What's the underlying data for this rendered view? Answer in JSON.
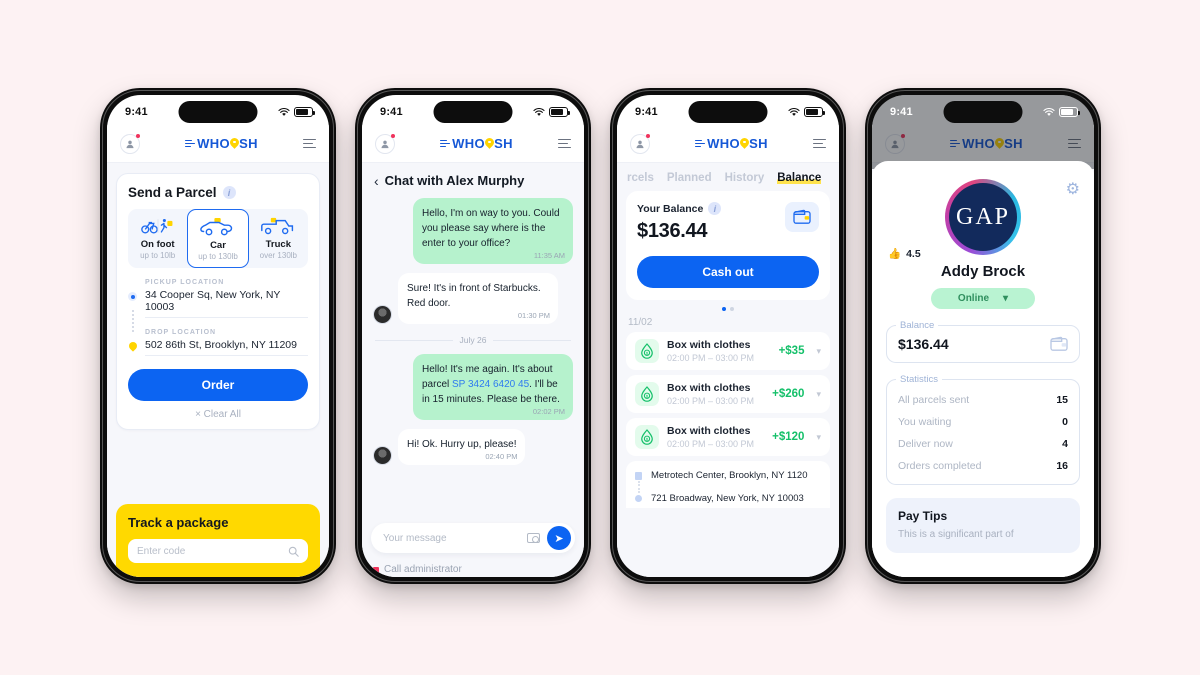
{
  "brand": {
    "name": "WHOOSH",
    "primary": "#0c64f2",
    "accent_yellow": "#ffd900",
    "accent_green": "#15c06a"
  },
  "status_bar": {
    "time": "9:41"
  },
  "phone1": {
    "card": {
      "title": "Send a Parcel",
      "modes": [
        {
          "name": "On foot",
          "sub": "up to 10lb",
          "icon": "bike-walk-icon"
        },
        {
          "name": "Car",
          "sub": "up to 130lb",
          "icon": "car-icon"
        },
        {
          "name": "Truck",
          "sub": "over 130lb",
          "icon": "truck-icon"
        }
      ],
      "selected_mode": "Car",
      "pickup_label": "PICKUP LOCATION",
      "pickup_value": "34 Cooper Sq, New York, NY 10003",
      "drop_label": "DROP LOCATION",
      "drop_value": "502 86th St, Brooklyn, NY 11209",
      "order_button": "Order",
      "clear_all": "×  Clear All"
    },
    "track": {
      "title": "Track a package",
      "placeholder": "Enter code"
    }
  },
  "phone2": {
    "header": "Chat with Alex Murphy",
    "messages": [
      {
        "from": "me",
        "text": "Hello, I'm on way to you. Could you please say where is the enter to your office?",
        "time": "11:35 AM"
      },
      {
        "from": "them",
        "text": "Sure! It's in front of Starbucks. Red door.",
        "time": "01:30 PM"
      }
    ],
    "date_separator": "July 26",
    "messages2": [
      {
        "from": "me",
        "text_a": "Hello! It's me again. It's about parcel ",
        "link": "SP 3424 6420 45",
        "text_b": ". I'll be in 15 minutes. Please be there.",
        "time": "02:02 PM"
      },
      {
        "from": "them",
        "text": "Hi! Ok. Hurry up, please!",
        "time": "02:40 PM"
      }
    ],
    "composer_placeholder": "Your message",
    "call_admin": "Call administrator"
  },
  "phone3": {
    "tabs": [
      {
        "label": "rcels",
        "active": false
      },
      {
        "label": "Planned",
        "active": false
      },
      {
        "label": "History",
        "active": false
      },
      {
        "label": "Balance",
        "active": true
      }
    ],
    "balance_label": "Your Balance",
    "balance_amount": "$136.44",
    "cash_out": "Cash out",
    "date_group": "11/02",
    "transactions": [
      {
        "name": "Box with clothes",
        "time": "02:00 PM – 03:00 PM",
        "amount": "+$35"
      },
      {
        "name": "Box with clothes",
        "time": "02:00 PM – 03:00 PM",
        "amount": "+$260"
      },
      {
        "name": "Box with clothes",
        "time": "02:00 PM – 03:00 PM",
        "amount": "+$120"
      }
    ],
    "addresses": [
      "Metrotech Center, Brooklyn, NY 1120",
      "721 Broadway, New York, NY 10003"
    ]
  },
  "phone4": {
    "avatar_text": "GAP",
    "rating": "4.5",
    "name": "Addy Brock",
    "status": "Online",
    "balance_label": "Balance",
    "balance_amount": "$136.44",
    "statistics_label": "Statistics",
    "statistics": [
      {
        "key": "All parcels sent",
        "value": "15"
      },
      {
        "key": "You waiting",
        "value": "0"
      },
      {
        "key": "Deliver now",
        "value": "4"
      },
      {
        "key": "Orders completed",
        "value": "16"
      }
    ],
    "tips_title": "Pay Tips",
    "tips_text": "This is a significant part of"
  }
}
